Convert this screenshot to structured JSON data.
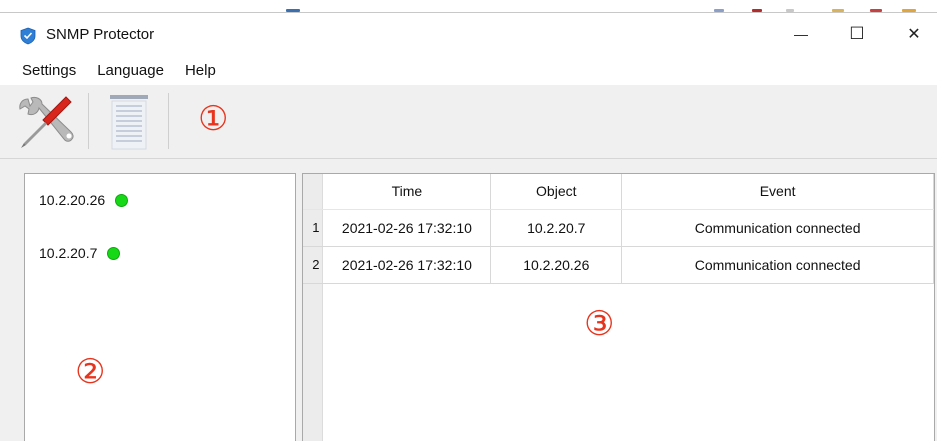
{
  "window": {
    "title": "SNMP Protector",
    "controls": {
      "minimize": "—",
      "maximize": "☐",
      "close": "✕"
    }
  },
  "menu": [
    "Settings",
    "Language",
    "Help"
  ],
  "toolbar": {
    "tools": [
      "wrench-screwdriver-icon",
      "document-list-icon"
    ]
  },
  "callouts": [
    "①",
    "②",
    "③"
  ],
  "devices": [
    {
      "ip": "10.2.20.26",
      "status_color": "#16d816"
    },
    {
      "ip": "10.2.20.7",
      "status_color": "#16d816"
    }
  ],
  "events_table": {
    "columns": [
      "Time",
      "Object",
      "Event"
    ],
    "rows": [
      {
        "num": "1",
        "time": "2021-02-26 17:32:10",
        "object": "10.2.20.7",
        "event": "Communication connected"
      },
      {
        "num": "2",
        "time": "2021-02-26 17:32:10",
        "object": "10.2.20.26",
        "event": "Communication connected"
      }
    ]
  },
  "colors": {
    "callout": "#e8341c",
    "status_online": "#16d816"
  }
}
